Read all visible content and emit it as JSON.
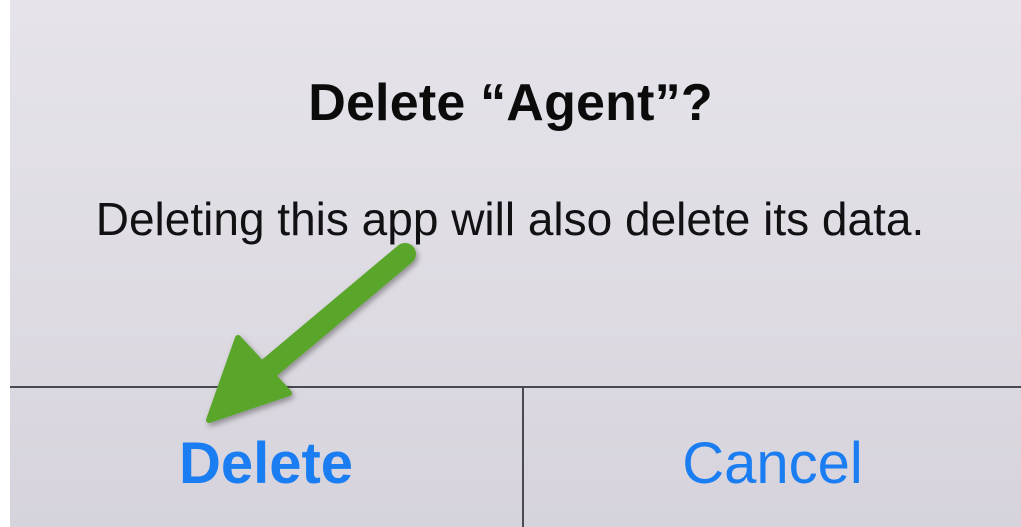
{
  "alert": {
    "title": "Delete “Agent”?",
    "message": "Deleting this app will also delete its data.",
    "actions": {
      "delete_label": "Delete",
      "cancel_label": "Cancel"
    }
  },
  "annotation": {
    "icon": "arrow-icon",
    "color": "#5aa629",
    "points_to": "delete-button"
  },
  "colors": {
    "action_blue": "#1a7df2",
    "background": "#e2dfe6",
    "divider": "#4a4850"
  }
}
